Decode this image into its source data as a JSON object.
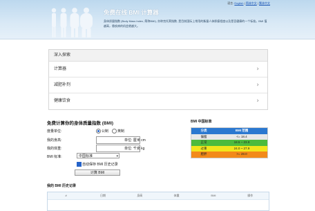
{
  "header": {
    "lang_prefix": "语言:",
    "langs": [
      "English",
      "简体中文",
      "繁体中文"
    ],
    "title": "免费在线 BMI 计算器",
    "desc": "身体质量指数 (Body Mass Index, 简称BMI), 亦称克托莱指数, 是目前国际上常用的衡量人体胖瘦程度以及是否健康的一个标准。BMI 值越高，患疾病的机会就越大。"
  },
  "explore": {
    "title": "深入探索",
    "items": [
      "计算器",
      "减肥补剂",
      "健康饮食"
    ]
  },
  "form": {
    "title": "免费计算你的身体质量指数 (BMI)",
    "unit_label": "度量单位:",
    "unit_metric": "公制",
    "unit_imperial": "英制",
    "height_label": "我的身高:",
    "height_unit": "单位: 厘米 cm",
    "weight_label": "我的体重:",
    "weight_unit": "单位: 千克 kg",
    "standard_label": "BMI 标准:",
    "standard_value": "中国标准",
    "save_label": "自动保存 BMI 历史记录",
    "submit_label": "计算 BMI"
  },
  "standard": {
    "title": "BMI 中国标准",
    "header": [
      "分类",
      "BMI 范围"
    ],
    "rows": [
      {
        "category": "偏瘦",
        "range": "<= 18.4",
        "color": "#e8e8e8"
      },
      {
        "category": "正常",
        "range": "18.5 ~ 23.9",
        "color": "#4cbb3d"
      },
      {
        "category": "过重",
        "range": "24.0 ~ 27.9",
        "color": "#f2e51c"
      },
      {
        "category": "肥胖",
        "range": ">= 28.0",
        "color": "#f28a1a"
      }
    ],
    "header_color": "#2b78d0"
  },
  "history": {
    "title": "我的 BMI 历史记录",
    "columns": [
      "#",
      "日期",
      "身高",
      "体重",
      "BMI",
      "操作"
    ]
  }
}
